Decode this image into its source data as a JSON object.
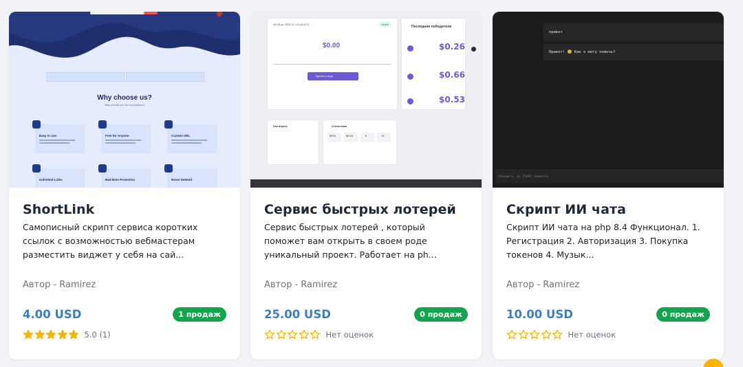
{
  "cards": [
    {
      "title": "ShortLink",
      "description": "Самописный скрипт сервиса коротких ссылок с возможностью вебмастерам разместить виджет у себя на сай...",
      "author": "Автор - Ramirez",
      "price": "4.00 USD",
      "sales": "1 продаж",
      "rating_text": "5.0 (1)",
      "stars_filled": 5,
      "thumb": {
        "ad_label": "Adsl.U banner space",
        "heading": "Why choose us?",
        "subheading": "Why should you try our product?",
        "features": [
          "Easy to use",
          "Free for Anyone",
          "Custom URL",
          "Unlimited Links",
          "Bad Bots Protection",
          "Never Deleted"
        ]
      }
    },
    {
      "title": "Сервис быстрых лотерей",
      "description": "Сервис быстрых лотерей , который поможет вам открыть в своем роде уникальный проект. Работает на ph...",
      "author": "Автор - Ramirez",
      "price": "25.00 USD",
      "sales": "0 продаж",
      "rating_text": "Нет оценок",
      "stars_filled": 0,
      "thumb": {
        "game_date": "06:08 pp 2025-07-13 (#1437)",
        "status": "active",
        "pool_amount": "$0.00",
        "button_label": "Купить у игру",
        "winners_title": "Последние победители",
        "winners": [
          "$0.26",
          "$0.66",
          "$0.53"
        ],
        "rules_title": "Как играть",
        "stats_title": "Статистика",
        "stats": [
          "5PIN",
          "$0.53",
          "0",
          "13"
        ]
      }
    },
    {
      "title": "Скрипт ИИ чата",
      "description": "Скрипт ИИ чата на php 8.4 Функционал. 1. Регистрация 2. Авторизация 3. Покупка токенов 4. Музык...",
      "author": "Автор - Ramirez",
      "price": "10.00 USD",
      "sales": "0 продаж",
      "rating_text": "Нет оценок",
      "stars_filled": 0,
      "thumb": {
        "user_message": "привет",
        "bot_message": "Привет! 😊 Как я могу помочь?",
        "input_placeholder": "Напишите… до 25000 символов"
      }
    }
  ]
}
